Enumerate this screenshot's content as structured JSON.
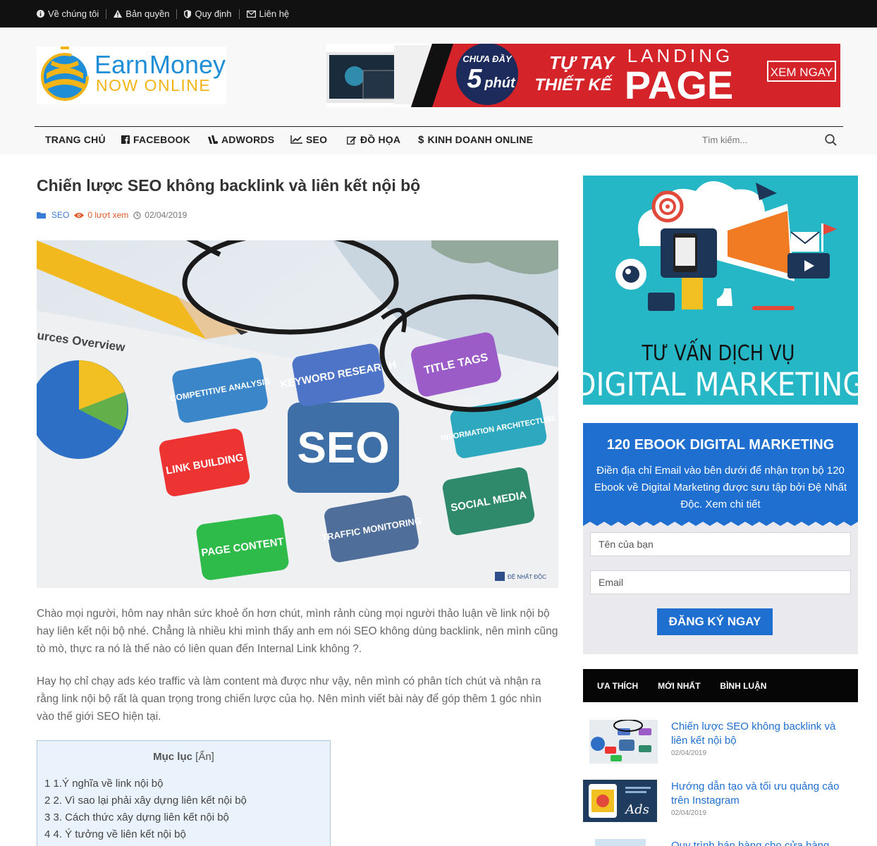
{
  "topbar": {
    "links": [
      {
        "label": "Về chúng tôi",
        "icon": "info-icon"
      },
      {
        "label": "Bản quyền",
        "icon": "warning-icon"
      },
      {
        "label": "Quy định",
        "icon": "shield-icon"
      },
      {
        "label": "Liên hệ",
        "icon": "envelope-icon"
      }
    ]
  },
  "logo": {
    "line1_a": "Earn",
    "line1_b": "Money",
    "line2": "NOW ONLINE"
  },
  "banner": {
    "badge_top": "CHƯA ĐẦY",
    "badge_num": "5",
    "badge_unit": "phút",
    "middle_1": "TỰ TAY",
    "middle_2": "THIẾT KẾ",
    "right_1": "LANDING",
    "right_2": "PAGE",
    "cta": "XEM NGAY"
  },
  "nav": {
    "items": [
      {
        "label": "TRANG CHỦ",
        "icon": ""
      },
      {
        "label": "FACEBOOK",
        "icon": "facebook-icon"
      },
      {
        "label": "ADWORDS",
        "icon": "adwords-icon"
      },
      {
        "label": "SEO",
        "icon": "chart-line-icon"
      },
      {
        "label": "ĐỒ HỌA",
        "icon": "edit-icon"
      },
      {
        "label": "KINH DOANH ONLINE",
        "icon": "dollar-icon"
      }
    ],
    "search_placeholder": "Tìm kiếm..."
  },
  "article": {
    "title": "Chiến lược SEO không backlink và liên kết nội bộ",
    "category": "SEO",
    "views": "0 lượt xem",
    "date": "02/04/2019",
    "image_labels": {
      "overview": "urces Overview",
      "center": "SEO",
      "bubbles": [
        "KEYWORD RESEARCH",
        "TITLE TAGS",
        "COMPETITIVE ANALYSIS",
        "INFORMATION ARCHITECTURE",
        "LINK BUILDING",
        "SOCIAL MEDIA",
        "PAGE CONTENT",
        "TRAFFIC MONITORING"
      ],
      "watermark": "ĐỆ NHẤT ĐỘC"
    },
    "paragraphs": [
      "Chào mọi người, hôm nay nhân sức khoẻ ổn hơn chút, mình rảnh cùng mọi người thảo luận về link nội bộ hay liên kết nội bộ nhé. Chẳng là nhiều khi mình thấy anh em nói SEO không dùng backlink, nên mình cũng tò mò, thực ra nó là thế nào có liên quan đến Internal Link không ?.",
      "Hay họ chỉ chạy ads kéo traffic và làm content mà được như vậy, nên mình có phân tích chút và nhận ra rằng link nội bộ rất là quan trọng trong chiến lược của họ. Nên mình viết bài này để góp thêm 1 góc nhìn vào thế giới SEO hiện tại."
    ],
    "toc": {
      "title": "Mục lục",
      "toggle": "[Ẩn]",
      "items": [
        "1 1.Ý nghĩa về link nội bộ",
        "2 2. Vì sao lại phải xây dựng liên kết nội bộ",
        "3 3. Cách thức xây dựng liên kết nội bộ",
        "4 4. Ý tưởng về liên kết nội bộ"
      ]
    }
  },
  "sidebar": {
    "ad": {
      "line1": "TƯ VẤN DỊCH VỤ",
      "line2": "DIGITAL MARKETING"
    },
    "ebook": {
      "title": "120 EBOOK DIGITAL MARKETING",
      "description": "Điền địa chỉ Email vào bên dưới để nhận trọn bộ 120 Ebook về Digital Marketing được sưu tập bởi Đệ Nhất Độc. Xem chi tiết",
      "name_placeholder": "Tên của bạn",
      "email_placeholder": "Email",
      "button": "ĐĂNG KÝ NGAY"
    },
    "tabs": [
      "ƯA THÍCH",
      "MỚI NHẤT",
      "BÌNH LUẬN"
    ],
    "posts": [
      {
        "title": "Chiến lược SEO không backlink và liên kết nội bộ",
        "date": "02/04/2019"
      },
      {
        "title": "Hướng dẫn tạo và tối ưu quảng cáo trên Instagram",
        "date": "02/04/2019",
        "thumb_text": "Ads"
      },
      {
        "title": "Quy trình bán hàng cho cửa hàng",
        "date": ""
      }
    ]
  },
  "colors": {
    "accent": "#1f6fd1",
    "topbar": "#111111",
    "views": "#e2592a",
    "ad_bg": "#26b7c7"
  }
}
